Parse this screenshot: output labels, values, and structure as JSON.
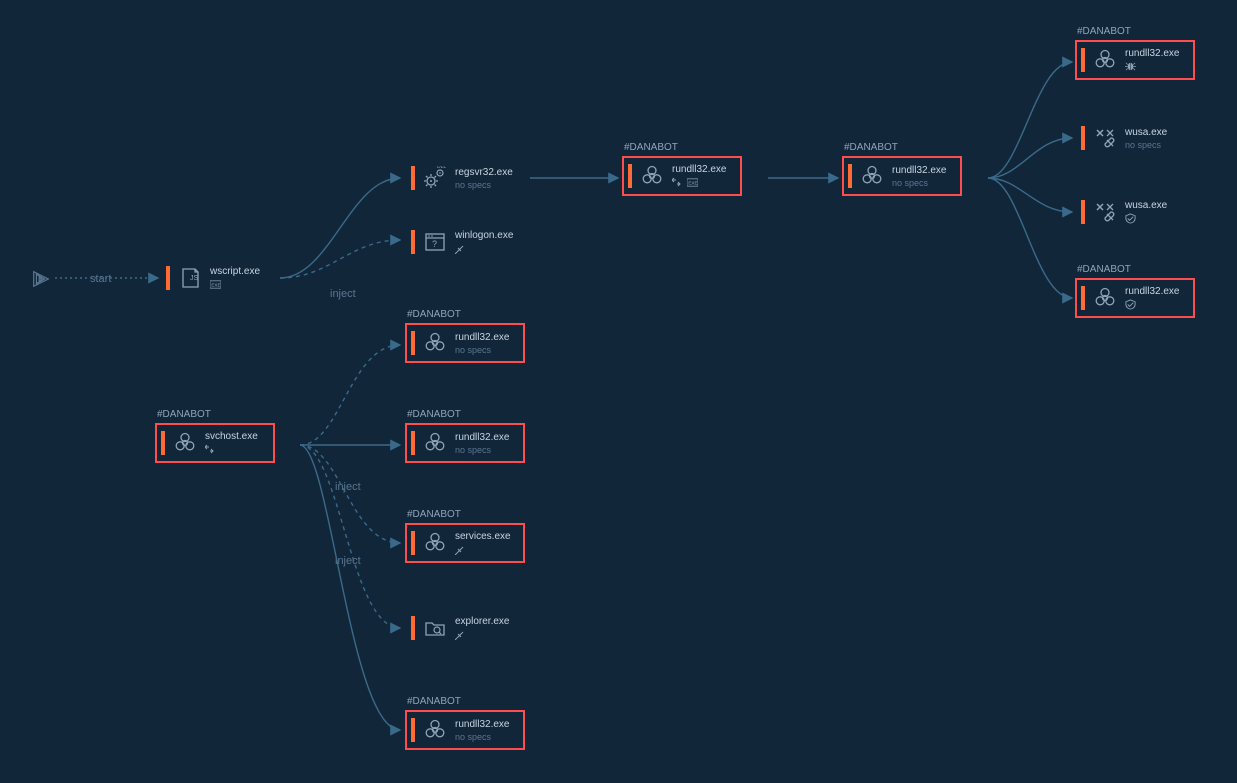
{
  "labels": {
    "start": "start",
    "inject1": "inject",
    "inject2": "inject",
    "inject3": "inject",
    "no_specs": "no specs"
  },
  "tag_danabot": "#DANABOT",
  "nodes": {
    "wscript": {
      "title": "wscript.exe"
    },
    "regsvr32": {
      "title": "regsvr32.exe"
    },
    "winlogon": {
      "title": "winlogon.exe"
    },
    "rundll32_1": {
      "title": "rundll32.exe"
    },
    "rundll32_2": {
      "title": "rundll32.exe"
    },
    "svchost": {
      "title": "svchost.exe"
    },
    "rundll32_3": {
      "title": "rundll32.exe"
    },
    "rundll32_4": {
      "title": "rundll32.exe"
    },
    "services": {
      "title": "services.exe"
    },
    "explorer": {
      "title": "explorer.exe"
    },
    "rundll32_5": {
      "title": "rundll32.exe"
    },
    "rundll32_top": {
      "title": "rundll32.exe"
    },
    "wusa1": {
      "title": "wusa.exe"
    },
    "wusa2": {
      "title": "wusa.exe"
    },
    "rundll32_bot": {
      "title": "rundll32.exe"
    }
  }
}
